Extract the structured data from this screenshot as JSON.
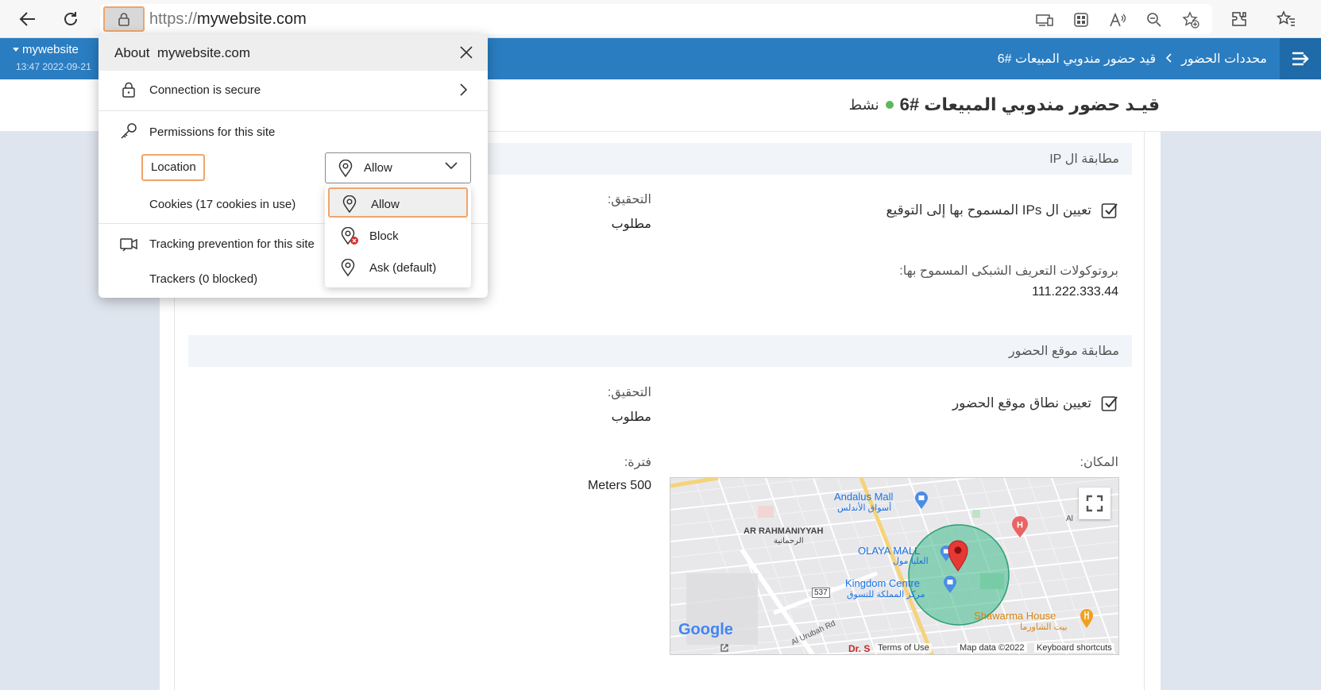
{
  "browser": {
    "url_scheme": "https://",
    "url_host": "mywebsite.com",
    "icons": [
      "back-icon",
      "refresh-icon",
      "lock-icon",
      "app-available-icon",
      "qr-code-icon",
      "read-aloud-icon",
      "zoom-out-icon",
      "add-favorite-icon",
      "extensions-icon",
      "favorites-icon"
    ]
  },
  "site_info": {
    "title": "About  mywebsite.com",
    "connection": "Connection is secure",
    "permissions_heading": "Permissions for this site",
    "location_label": "Location",
    "location_value": "Allow",
    "cookies": "Cookies (17 cookies in use)",
    "tracking_heading": "Tracking prevention for this site",
    "trackers": "Trackers (0 blocked)",
    "options": [
      {
        "label": "Allow",
        "icon": "location-pin-icon",
        "selected": true
      },
      {
        "label": "Block",
        "icon": "location-block-icon",
        "selected": false
      },
      {
        "label": "Ask (default)",
        "icon": "location-pin-icon",
        "selected": false
      }
    ]
  },
  "app": {
    "user_name": "mywebsite",
    "user_time": "13:47 2022-09-21",
    "breadcrumb": [
      "محددات الحضور",
      "قيد حضور مندوبي المبيعات #6"
    ],
    "page_title": "قيـد حضور مندوبي المبيعات #6",
    "status": "نشط",
    "status_color": "#5cb85c",
    "accent": "#2a7dc1"
  },
  "ip_section": {
    "title": "مطابقة ال IP",
    "check_label": "تعيين ال IPs المسموح بها إلى التوقيع",
    "verification_label": "التحقيق:",
    "verification_value": "مطلوب",
    "allowed_label": "بروتوكولات التعريف الشبكى المسموح بها:",
    "allowed_value": "111.222.333.44"
  },
  "location_section": {
    "title": "مطابقة موقع الحضور",
    "check_label": "تعيين نطاق موقع الحضور",
    "verification_label": "التحقيق:",
    "verification_value": "مطلوب",
    "place_label": "المكان:",
    "range_label": "فترة:",
    "range_value": "Meters 500"
  },
  "map": {
    "labels": {
      "andalus_en": "Andalus Mall",
      "andalus_ar": "أسواق الأندلس",
      "rahmaniyyah_en": "AR RAHMANIYYAH",
      "rahmaniyyah_ar": "الرحمانية",
      "olaya_en": "OLAYA MALL",
      "olaya_ar": "العليا مول",
      "kingdom_en": "Kingdom Centre",
      "kingdom_ar": "مركز المملكة للتسوق",
      "shawarma_en": "Shawarma House",
      "shawarma_ar": "بيت الشاورما",
      "road_shield": "537",
      "road_name": "Al Urubah Rd",
      "partial_street": "Dr. S",
      "partial_edge": "Al",
      "hospital_letter": "H"
    },
    "google": "Google",
    "terms": "Terms of Use",
    "map_data": "Map data ©2022",
    "shortcuts": "Keyboard shortcuts"
  }
}
